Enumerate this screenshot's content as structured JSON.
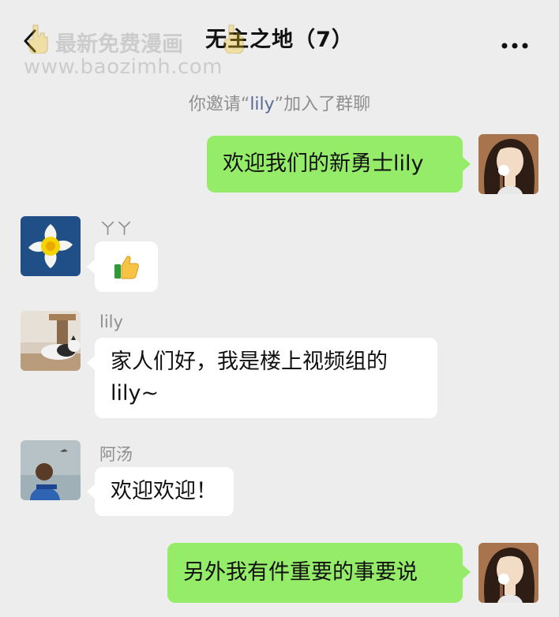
{
  "header": {
    "title": "无主之地（7）"
  },
  "watermark": {
    "line1": "最新免费漫画",
    "line2": "www.baozimh.com"
  },
  "system_message": {
    "prefix": "你邀请",
    "invitee_open": "“",
    "invitee": "lily",
    "invitee_close": "”",
    "suffix": "加入了群聊"
  },
  "messages": [
    {
      "sender": "self",
      "text": "欢迎我们的新勇士lily"
    },
    {
      "sender": "ㄚㄚ",
      "sender_label": "ㄚㄚ",
      "text": ""
    },
    {
      "sender": "lily",
      "sender_label": "lily",
      "text_line1": "家人们好，我是楼上视频组的",
      "text_line2": "lily~"
    },
    {
      "sender": "阿汤",
      "sender_label": "阿汤",
      "text": "欢迎欢迎！"
    },
    {
      "sender": "self",
      "text": "另外我有件重要的事要说"
    }
  ],
  "icons": {
    "back": "chevron-left-icon",
    "more": "more-dots-icon",
    "thumbs_up": "thumbs-up-icon",
    "watermark_hand": "pointing-down-hand-icon"
  },
  "colors": {
    "background": "#ededed",
    "self_bubble": "#95ec69",
    "other_bubble": "#ffffff",
    "system_text": "#8f8f8f",
    "invitee_link": "#576b95"
  }
}
